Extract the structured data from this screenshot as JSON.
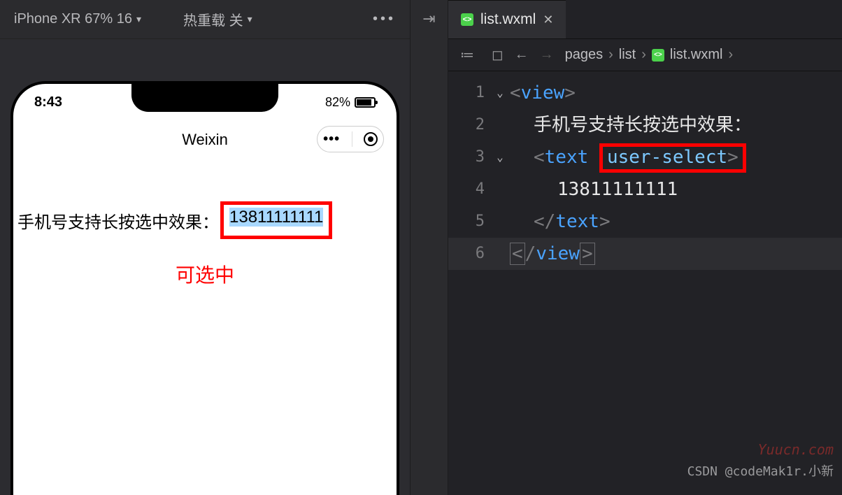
{
  "sim_toolbar": {
    "device_label": "iPhone XR 67% 16",
    "hot_reload_label": "热重载 关"
  },
  "phone": {
    "time": "8:43",
    "battery_pct": "82%",
    "app_title": "Weixin",
    "line_label": "手机号支持长按选中效果：",
    "phone_number": "13811111111",
    "annotation": "可选中"
  },
  "editor": {
    "tab_filename": "list.wxml",
    "breadcrumbs": {
      "p1": "pages",
      "p2": "list",
      "p3": "list.wxml"
    },
    "lines": {
      "l1_tag": "view",
      "l2_text": "手机号支持长按选中效果：",
      "l3_tag": "text",
      "l3_attr": "user-select",
      "l4_text": "13811111111",
      "l5_tag": "text",
      "l6_tag": "view"
    },
    "linenums": {
      "n1": "1",
      "n2": "2",
      "n3": "3",
      "n4": "4",
      "n5": "5",
      "n6": "6"
    }
  },
  "watermark": "Yuucn.com",
  "credit": "CSDN @codeMak1r.小新"
}
